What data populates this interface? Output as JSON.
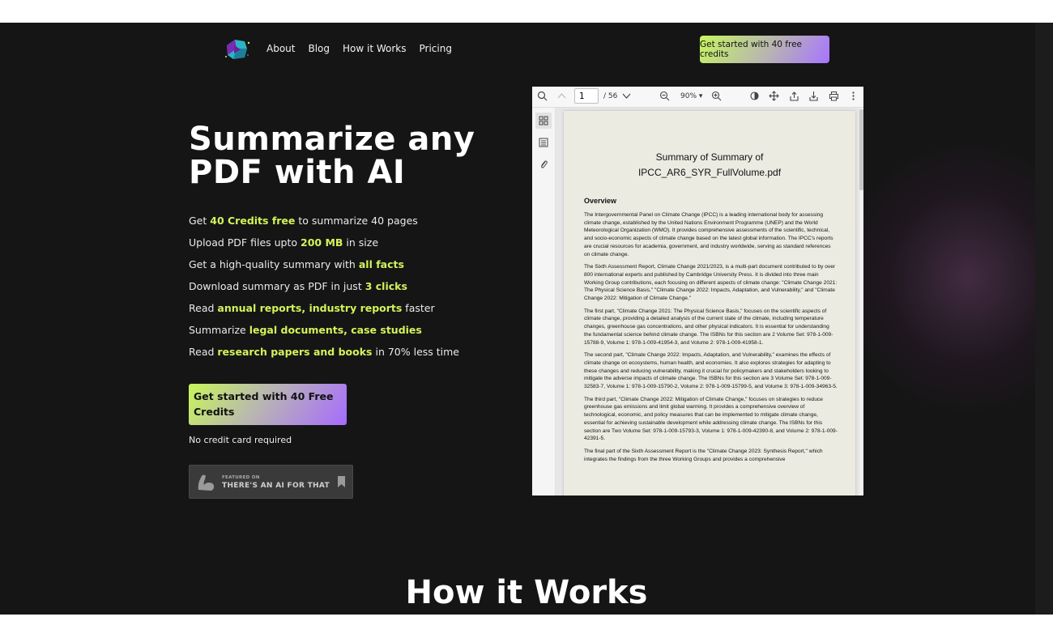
{
  "nav": {
    "links": [
      "About",
      "Blog",
      "How it Works",
      "Pricing"
    ],
    "cta": "Get started with 40 free credits"
  },
  "hero": {
    "title": "Summarize any PDF with AI",
    "features": [
      {
        "pre": "Get ",
        "hl": "40 Credits free",
        "post": " to summarize 40 pages"
      },
      {
        "pre": "Upload PDF files upto ",
        "hl": "200 MB",
        "post": " in size"
      },
      {
        "pre": "Get a high-quality summary with ",
        "hl": "all facts",
        "post": ""
      },
      {
        "pre": "Download summary as PDF in just ",
        "hl": "3 clicks",
        "post": ""
      },
      {
        "pre": "Read ",
        "hl": "annual reports, industry reports",
        "post": " faster"
      },
      {
        "pre": "Summarize ",
        "hl": "legal documents, case studies",
        "post": ""
      },
      {
        "pre": "Read ",
        "hl": "research papers and books",
        "post": " in 70% less time"
      }
    ],
    "cta": "Get started with 40 Free Credits",
    "note": "No credit card required",
    "badge": {
      "small": "FEATURED ON",
      "big": "THERE'S AN AI FOR THAT"
    }
  },
  "viewer": {
    "page_current": "1",
    "page_total": "/ 56",
    "zoom": "90% ▾",
    "doc_title_line1": "Summary of Summary of",
    "doc_title_line2": "IPCC_AR6_SYR_FullVolume.pdf",
    "overview": "Overview",
    "paragraphs": [
      "The Intergovernmental Panel on Climate Change (IPCC) is a leading international body for assessing climate change, established by the United Nations Environment Programme (UNEP) and the World Meteorological Organization (WMO). It provides comprehensive assessments of the scientific, technical, and socio-economic aspects of climate change based on the latest global information. The IPCC's reports are crucial resources for academia, government, and industry worldwide, serving as standard references on climate change.",
      "The Sixth Assessment Report, Climate Change 2021/2023, is a multi-part document contributed to by over 800 international experts and published by Cambridge University Press. It is divided into three main Working Group contributions, each focusing on different aspects of climate change: \"Climate Change 2021: The Physical Science Basis,\" \"Climate Change 2022: Impacts, Adaptation, and Vulnerability,\" and \"Climate Change 2022: Mitigation of Climate Change.\"",
      "The first part, \"Climate Change 2021: The Physical Science Basis,\" focuses on the scientific aspects of climate change, providing a detailed analysis of the current state of the climate, including temperature changes, greenhouse gas concentrations, and other physical indicators. It is essential for understanding the fundamental science behind climate change. The ISBNs for this section are 2 Volume Set: 978-1-009-15788-9, Volume 1: 978-1-009-41954-3, and Volume 2: 978-1-009-41958-1.",
      "The second part, \"Climate Change 2022: Impacts, Adaptation, and Vulnerability,\" examines the effects of climate change on ecosystems, human health, and economies. It also explores strategies for adapting to these changes and reducing vulnerability, making it crucial for policymakers and stakeholders looking to mitigate the adverse impacts of climate change. The ISBNs for this section are 3 Volume Set: 978-1-009-32583-7, Volume 1: 978-1-009-15790-2, Volume 2: 978-1-009-15799-5, and Volume 3: 978-1-009-34963-5.",
      "The third part, \"Climate Change 2022: Mitigation of Climate Change,\" focuses on strategies to reduce greenhouse gas emissions and limit global warming. It provides a comprehensive overview of technological, economic, and policy measures that can be implemented to mitigate climate change, essential for achieving sustainable development while addressing climate change. The ISBNs for this section are Two Volume Set: 978-1-009-15793-3, Volume 1: 978-1-009-42390-8, and Volume 2: 978-1-009-42391-5.",
      "The final part of the Sixth Assessment Report is the \"Climate Change 2023: Synthesis Report,\" which integrates the findings from the three Working Groups and provides a comprehensive"
    ]
  },
  "section": {
    "how_title": "How it Works"
  },
  "colors": {
    "accent_green": "#d3f35a",
    "accent_purple": "#a66bff",
    "background": "#151515"
  }
}
